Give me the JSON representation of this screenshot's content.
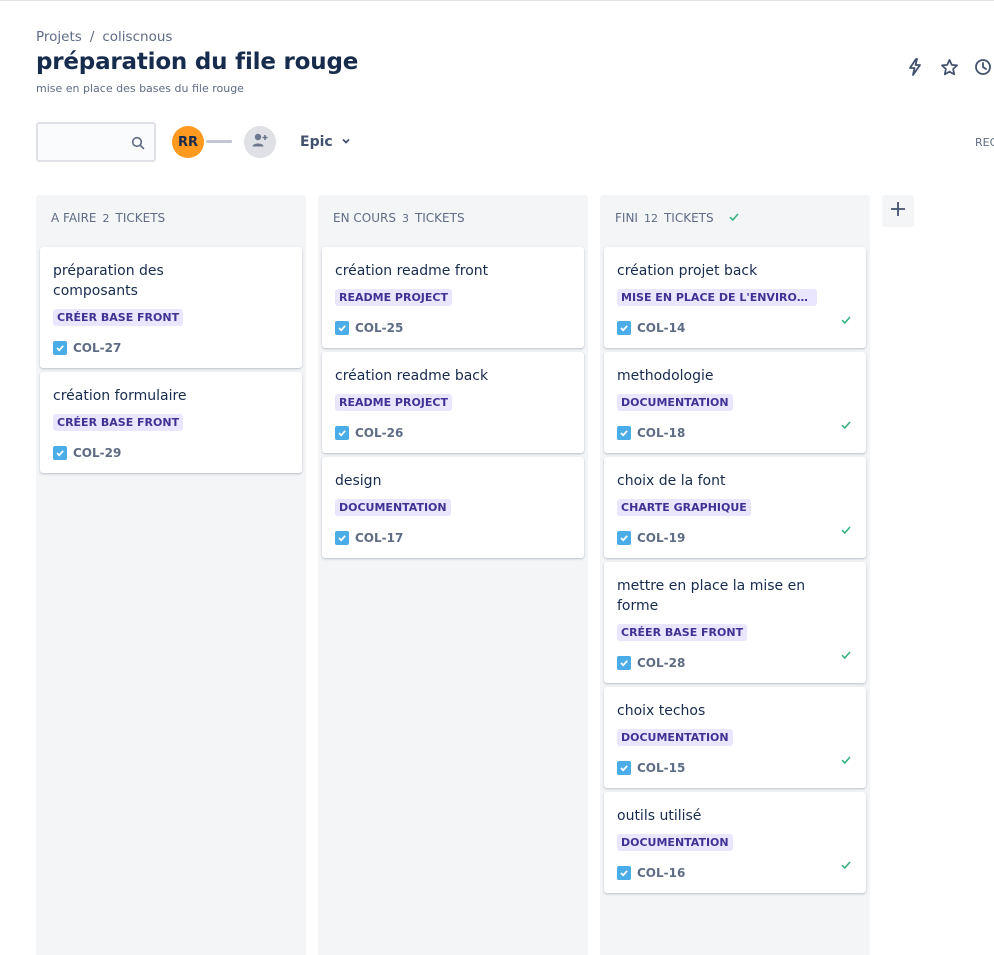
{
  "breadcrumb": {
    "root": "Projets",
    "separator": "/",
    "project": "coliscnous"
  },
  "header": {
    "title": "préparation du file rouge",
    "subtitle": "mise en place des bases du file rouge",
    "icons": [
      "lightning-icon",
      "star-icon",
      "clock-icon"
    ]
  },
  "toolbar": {
    "search": {
      "value": "",
      "placeholder": ""
    },
    "avatar_initials": "RR",
    "epic_filter_label": "Epic",
    "grouping_label": "REG"
  },
  "colors": {
    "accent": "#0052cc",
    "done": "#36b37e",
    "epic_bg": "#eae6ff",
    "epic_text": "#403294",
    "avatar": "#ff991f"
  },
  "columns": [
    {
      "name": "A FAIRE",
      "count": "2",
      "count_label": "TICKETS",
      "done": false,
      "cards": [
        {
          "title": "préparation des composants",
          "epic": "CRÉER BASE FRONT",
          "key": "COL-27",
          "done": false
        },
        {
          "title": "création formulaire",
          "epic": "CRÉER BASE FRONT",
          "key": "COL-29",
          "done": false
        }
      ]
    },
    {
      "name": "EN COURS",
      "count": "3",
      "count_label": "TICKETS",
      "done": false,
      "cards": [
        {
          "title": "création readme front",
          "epic": "README PROJECT",
          "key": "COL-25",
          "done": false
        },
        {
          "title": "création readme back",
          "epic": "README PROJECT",
          "key": "COL-26",
          "done": false
        },
        {
          "title": "design",
          "epic": "DOCUMENTATION",
          "key": "COL-17",
          "done": false
        }
      ]
    },
    {
      "name": "FINI",
      "count": "12",
      "count_label": "TICKETS",
      "done": true,
      "cards": [
        {
          "title": "création projet back",
          "epic": "MISE EN PLACE DE L'ENVIRONNE...",
          "key": "COL-14",
          "done": true
        },
        {
          "title": "methodologie",
          "epic": "DOCUMENTATION",
          "key": "COL-18",
          "done": true
        },
        {
          "title": "choix de la font",
          "epic": "CHARTE GRAPHIQUE",
          "key": "COL-19",
          "done": true
        },
        {
          "title": "mettre en place la mise en forme",
          "epic": "CRÉER BASE FRONT",
          "key": "COL-28",
          "done": true
        },
        {
          "title": "choix techos",
          "epic": "DOCUMENTATION",
          "key": "COL-15",
          "done": true
        },
        {
          "title": "outils utilisé",
          "epic": "DOCUMENTATION",
          "key": "COL-16",
          "done": true
        }
      ]
    }
  ]
}
